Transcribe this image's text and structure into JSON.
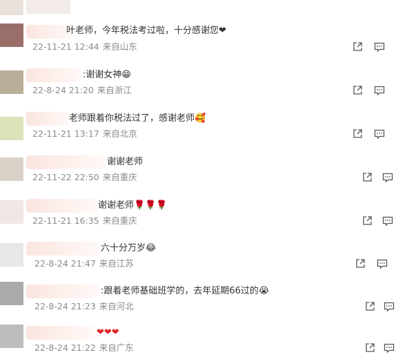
{
  "comments": [
    {
      "text": "叶老师，今年税法考过啦，十分感谢您❤",
      "date": "22-11-21 12:44",
      "location": "来自山东"
    },
    {
      "text": ":谢谢女神😁",
      "date": "22-8-24 21:20",
      "location": "来自浙江"
    },
    {
      "text": "老师跟着你税法过了，感谢老师🥰",
      "date": "22-11-21 13:17",
      "location": "来自北京"
    },
    {
      "text": "谢谢老师",
      "date": "22-11-22 22:50",
      "location": "来自重庆"
    },
    {
      "text": "谢谢老师🌹🌹🌹",
      "date": "22-11-21 16:35",
      "location": "来自重庆"
    },
    {
      "text": "六十分万岁😂",
      "date": "22-8-24 21:47",
      "location": "来自江苏"
    },
    {
      "text": ":跟着老师基础班学的，去年延期66过的😭",
      "date": "22-8-24 21:23",
      "location": "来自河北"
    },
    {
      "text": "❤❤❤",
      "date": "22-8-24 21:22",
      "location": "来自广东"
    }
  ]
}
